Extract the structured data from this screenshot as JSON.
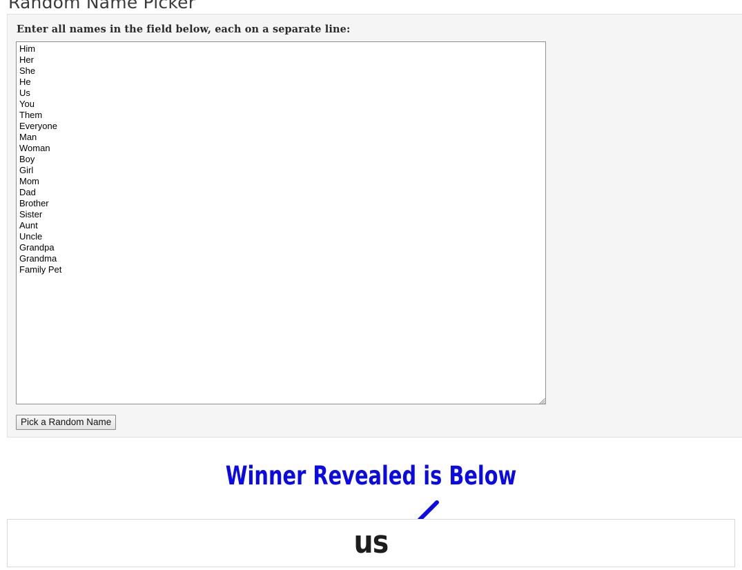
{
  "page": {
    "title": "Random Name Picker"
  },
  "picker": {
    "instruction": "Enter all names in the field below, each on a separate line:",
    "names": [
      "Him",
      "Her",
      "She",
      "He",
      "Us",
      "You",
      "Them",
      "Everyone",
      "Man",
      "Woman",
      "Boy",
      "Girl",
      "Mom",
      "Dad",
      "Brother",
      "Sister",
      "Aunt",
      "Uncle",
      "Grandpa",
      "Grandma",
      "Family Pet"
    ],
    "names_text": "Him\nHer\nShe\nHe\nUs\nYou\nThem\nEveryone\nMan\nWoman\nBoy\nGirl\nMom\nDad\nBrother\nSister\nAunt\nUncle\nGrandpa\nGrandma\nFamily Pet",
    "textarea_placeholder": "",
    "pick_button_label": "Pick a Random Name",
    "resize_grip_icon": "resize-handle-icon"
  },
  "annotation": {
    "headline": "Winner Revealed is Below",
    "headline_color": "#0a0ae6",
    "arrow_icon": "down-left-arrow-icon",
    "arrow_color": "#0a0ae6"
  },
  "result": {
    "winner_name": "us",
    "winner_color": "#1d1d1d"
  },
  "colors": {
    "panel_background": "#f5f5f5",
    "panel_border": "#e2e2e2",
    "textarea_border": "#8f8f8f",
    "result_border": "#d8d8d8",
    "page_background": "#ffffff"
  }
}
